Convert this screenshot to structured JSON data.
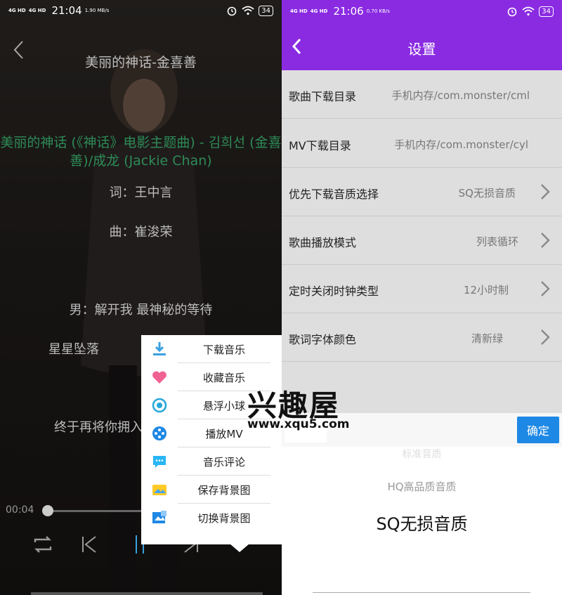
{
  "left": {
    "status": {
      "signal1": "4G HD",
      "signal2": "4G HD",
      "time": "21:04",
      "rate": "1.90 MB/s",
      "battery": "34"
    },
    "song_title": "美丽的神话-金喜善",
    "lyrics": {
      "highlight": "美丽的神话 (《神话》电影主题曲) - 김희선 (金喜善)/成龙 (Jackie Chan)",
      "lines": [
        "词：王中言",
        "曲：崔浚荣",
        "男：解开我 最神秘的等待",
        "星星坠落",
        "终于再将你拥入"
      ]
    },
    "elapsed": "00:04",
    "menu": [
      {
        "label": "下载音乐",
        "icon": "download-icon"
      },
      {
        "label": "收藏音乐",
        "icon": "heart-icon"
      },
      {
        "label": "悬浮小球",
        "icon": "floating-ball-icon"
      },
      {
        "label": "播放MV",
        "icon": "film-reel-icon"
      },
      {
        "label": "音乐评论",
        "icon": "comment-icon"
      },
      {
        "label": "保存背景图",
        "icon": "save-image-icon"
      },
      {
        "label": "切换背景图",
        "icon": "switch-image-icon"
      }
    ]
  },
  "right": {
    "status": {
      "signal1": "4G HD",
      "signal2": "4G HD",
      "time": "21:06",
      "rate": "0.70 KB/s",
      "battery": "34"
    },
    "title": "设置",
    "settings": [
      {
        "label": "歌曲下载目录",
        "value": "手机内存/com.monster/cml"
      },
      {
        "label": "MV下载目录",
        "value": "手机内存/com.monster/cyl"
      },
      {
        "label": "优先下载音质选择",
        "value": "SQ无损音质"
      },
      {
        "label": "歌曲播放模式",
        "value": "列表循环"
      },
      {
        "label": "定时关闭时钟类型",
        "value": "12小时制"
      },
      {
        "label": "歌词字体颜色",
        "value": "清新绿"
      }
    ],
    "picker": {
      "confirm": "确定",
      "options": [
        "标准音质",
        "HQ高品质音质",
        "SQ无损音质"
      ]
    }
  },
  "watermark": {
    "text": "兴趣屋",
    "url": "www.xqu5.com"
  },
  "colors": {
    "header_purple": "#8a2be2",
    "confirm_blue": "#1e88e5",
    "lyric_green": "#2e8b57"
  }
}
